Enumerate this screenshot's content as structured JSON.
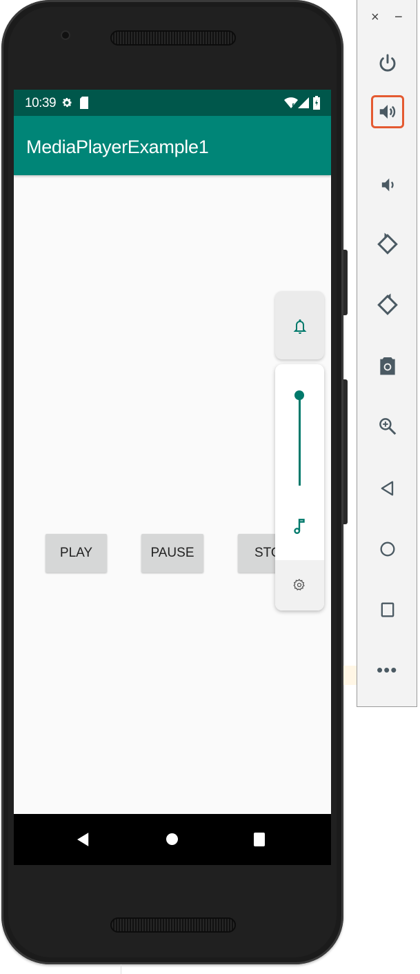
{
  "status_bar": {
    "time": "10:39"
  },
  "app": {
    "title": "MediaPlayerExample1",
    "buttons": {
      "play": "PLAY",
      "pause": "PAUSE",
      "stop": "STO"
    }
  },
  "volume_panel": {
    "ringer_icon": "bell-icon",
    "media_icon": "music-note-icon",
    "settings_icon": "gear-icon",
    "media_volume_level": 1.0
  },
  "navigation": {
    "back": "back-triangle",
    "home": "home-circle",
    "recents": "recents-square"
  },
  "emulator_toolbar": {
    "close_label": "×",
    "minimize_label": "−",
    "more_label": "•••",
    "items": [
      {
        "name": "power-icon"
      },
      {
        "name": "volume-up-icon",
        "selected": true
      },
      {
        "name": "volume-down-icon"
      },
      {
        "name": "rotate-left-icon"
      },
      {
        "name": "rotate-right-icon"
      },
      {
        "name": "camera-icon"
      },
      {
        "name": "zoom-icon"
      },
      {
        "name": "back-icon"
      },
      {
        "name": "home-icon"
      },
      {
        "name": "overview-icon"
      }
    ]
  },
  "colors": {
    "primary": "#008577",
    "primary_dark": "#00574B",
    "accent": "#00796B",
    "selection": "#E45A31"
  }
}
